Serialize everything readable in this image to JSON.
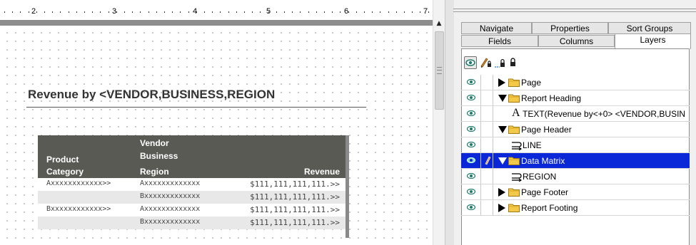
{
  "ruler": {
    "numbers": [
      "2",
      "3",
      "4",
      "5",
      "6",
      "7"
    ]
  },
  "report": {
    "title": "Revenue by <VENDOR,BUSINESS,REGION",
    "matrix": {
      "headers": {
        "product_line1": "Product",
        "product_line2": "Category",
        "vendor_line1": "Vendor",
        "vendor_line2": "Business",
        "vendor_line3": "Region",
        "revenue": "Revenue"
      },
      "rows": [
        {
          "category": "Axxxxxxxxxxxx>>",
          "vendor": "Axxxxxxxxxxxxx",
          "revenue": "$111,111,111,111.>>"
        },
        {
          "category": "",
          "vendor": "Bxxxxxxxxxxxxx",
          "revenue": "$111,111,111,111.>>"
        },
        {
          "category": "Bxxxxxxxxxxxx>>",
          "vendor": "Axxxxxxxxxxxxx",
          "revenue": "$111,111,111,111.>>"
        },
        {
          "category": "",
          "vendor": "Bxxxxxxxxxxxxx",
          "revenue": "$111,111,111,111.>>"
        }
      ]
    }
  },
  "panel": {
    "tabs_row1": [
      "Navigate",
      "Properties",
      "Sort Groups"
    ],
    "tabs_row2": [
      "Fields",
      "Columns",
      "Layers"
    ],
    "active_tab": "Layers",
    "toolbar_icons": [
      "eye-icon",
      "pencil-lock-icon",
      "lock-open-icon",
      "lock-icon"
    ],
    "tree": [
      {
        "label": "Page",
        "icon": "folder-icon",
        "expander": "collapsed"
      },
      {
        "label": "Report Heading",
        "icon": "folder-icon",
        "expander": "expanded"
      },
      {
        "label": "TEXT(Revenue by<+0> <VENDOR,BUSIN",
        "icon": "text-icon"
      },
      {
        "label": "Page Header",
        "icon": "folder-icon",
        "expander": "expanded"
      },
      {
        "label": "LINE",
        "icon": "line-icon"
      },
      {
        "label": "Data Matrix",
        "icon": "folder-icon",
        "expander": "expanded",
        "selected": true
      },
      {
        "label": "REGION",
        "icon": "line-icon"
      },
      {
        "label": "Page Footer",
        "icon": "folder-icon",
        "expander": "collapsed"
      },
      {
        "label": "Report Footing",
        "icon": "folder-icon",
        "expander": "collapsed"
      }
    ],
    "colors": {
      "selection": "#0a27d8",
      "header_bg": "#5a5a55",
      "eye": "#1f7a6e"
    }
  }
}
